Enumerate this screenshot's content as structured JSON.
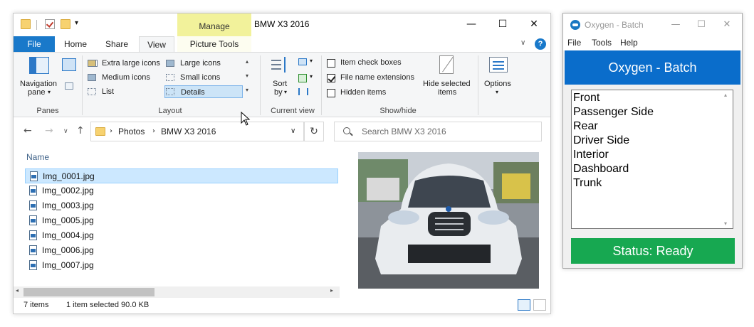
{
  "explorer": {
    "title": "BMW X3 2016",
    "manage_label": "Manage",
    "tabs": {
      "file": "File",
      "home": "Home",
      "share": "Share",
      "view": "View",
      "picture_tools": "Picture Tools"
    },
    "ribbon": {
      "panes": {
        "navigation_pane": "Navigation",
        "navigation_pane_2": "pane",
        "label": "Panes"
      },
      "layout": {
        "items": [
          "Extra large icons",
          "Large icons",
          "Medium icons",
          "Small icons",
          "List",
          "Details"
        ],
        "label": "Layout"
      },
      "current_view": {
        "sort_by": "Sort",
        "sort_by_2": "by",
        "label": "Current view"
      },
      "show_hide": {
        "item_check_boxes": "Item check boxes",
        "file_name_extensions": "File name extensions",
        "hidden_items": "Hidden items",
        "hide_selected_items": "Hide selected",
        "hide_selected_items_2": "items",
        "label": "Show/hide"
      },
      "options": "Options"
    },
    "address": {
      "segments": [
        "Photos",
        "BMW X3 2016"
      ]
    },
    "search_placeholder": "Search BMW X3 2016",
    "column_name": "Name",
    "files": [
      "Img_0001.jpg",
      "Img_0002.jpg",
      "Img_0003.jpg",
      "Img_0005.jpg",
      "Img_0004.jpg",
      "Img_0006.jpg",
      "Img_0007.jpg"
    ],
    "status": {
      "count": "7 items",
      "selection": "1 item selected  90.0 KB"
    }
  },
  "oxygen": {
    "title": "Oxygen - Batch",
    "menu": [
      "File",
      "Tools",
      "Help"
    ],
    "header": "Oxygen - Batch",
    "list": [
      "Front",
      "Passenger Side",
      "Rear",
      "Driver Side",
      "Interior",
      "Dashboard",
      "Trunk"
    ],
    "status": "Status: Ready"
  },
  "colors": {
    "file_tab": "#1979ca",
    "manage_tab": "#f2f29b",
    "oxygen_header": "#0a6dcb",
    "oxygen_status": "#17a851",
    "selection": "#cce8ff"
  }
}
